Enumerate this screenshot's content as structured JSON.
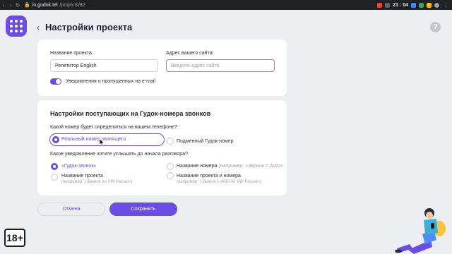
{
  "browser": {
    "url_host": "in.gudok.tel",
    "url_path": "/projects/82",
    "clock": "21 : 04"
  },
  "header": {
    "title": "Настройки проекта",
    "help": "?"
  },
  "project": {
    "name_label": "Название проекта:",
    "name_value": "Репетитор English",
    "site_label": "Адрес вашего сайта:",
    "site_placeholder": "Введите адрес сайта",
    "notify_label": "Уведомления о пропущенных на e-mail",
    "notify_enabled": true
  },
  "calls": {
    "title": "Настройки поступающих на Гудок-номера звонков",
    "q1": "Какой номер будет определяться на вашем телефоне?",
    "q1_options": [
      "Реальный номер звонящего",
      "Подменный Гудок-номер"
    ],
    "q1_selected": 0,
    "q2": "Какое уведомление хотите услышать до начала разговора?",
    "q2_options": [
      {
        "label": "«Гудок-звонок»",
        "hint": "",
        "sub": ""
      },
      {
        "label": "Название номера",
        "hint": "(например: «Звонок с Avito»",
        "sub": ""
      },
      {
        "label": "Название проекта",
        "hint": "",
        "sub": "(например: «Звонок по VW Passat»)"
      },
      {
        "label": "Название проекта и номера",
        "hint": "",
        "sub": "(например: «Звонок с Avito по VW Passat»)"
      }
    ],
    "q2_selected": 0
  },
  "actions": {
    "cancel": "Отмена",
    "save": "Сохранить"
  },
  "badge": {
    "age": "18+"
  },
  "colors": {
    "accent": "#6b4de6",
    "background": "#edeef2"
  }
}
